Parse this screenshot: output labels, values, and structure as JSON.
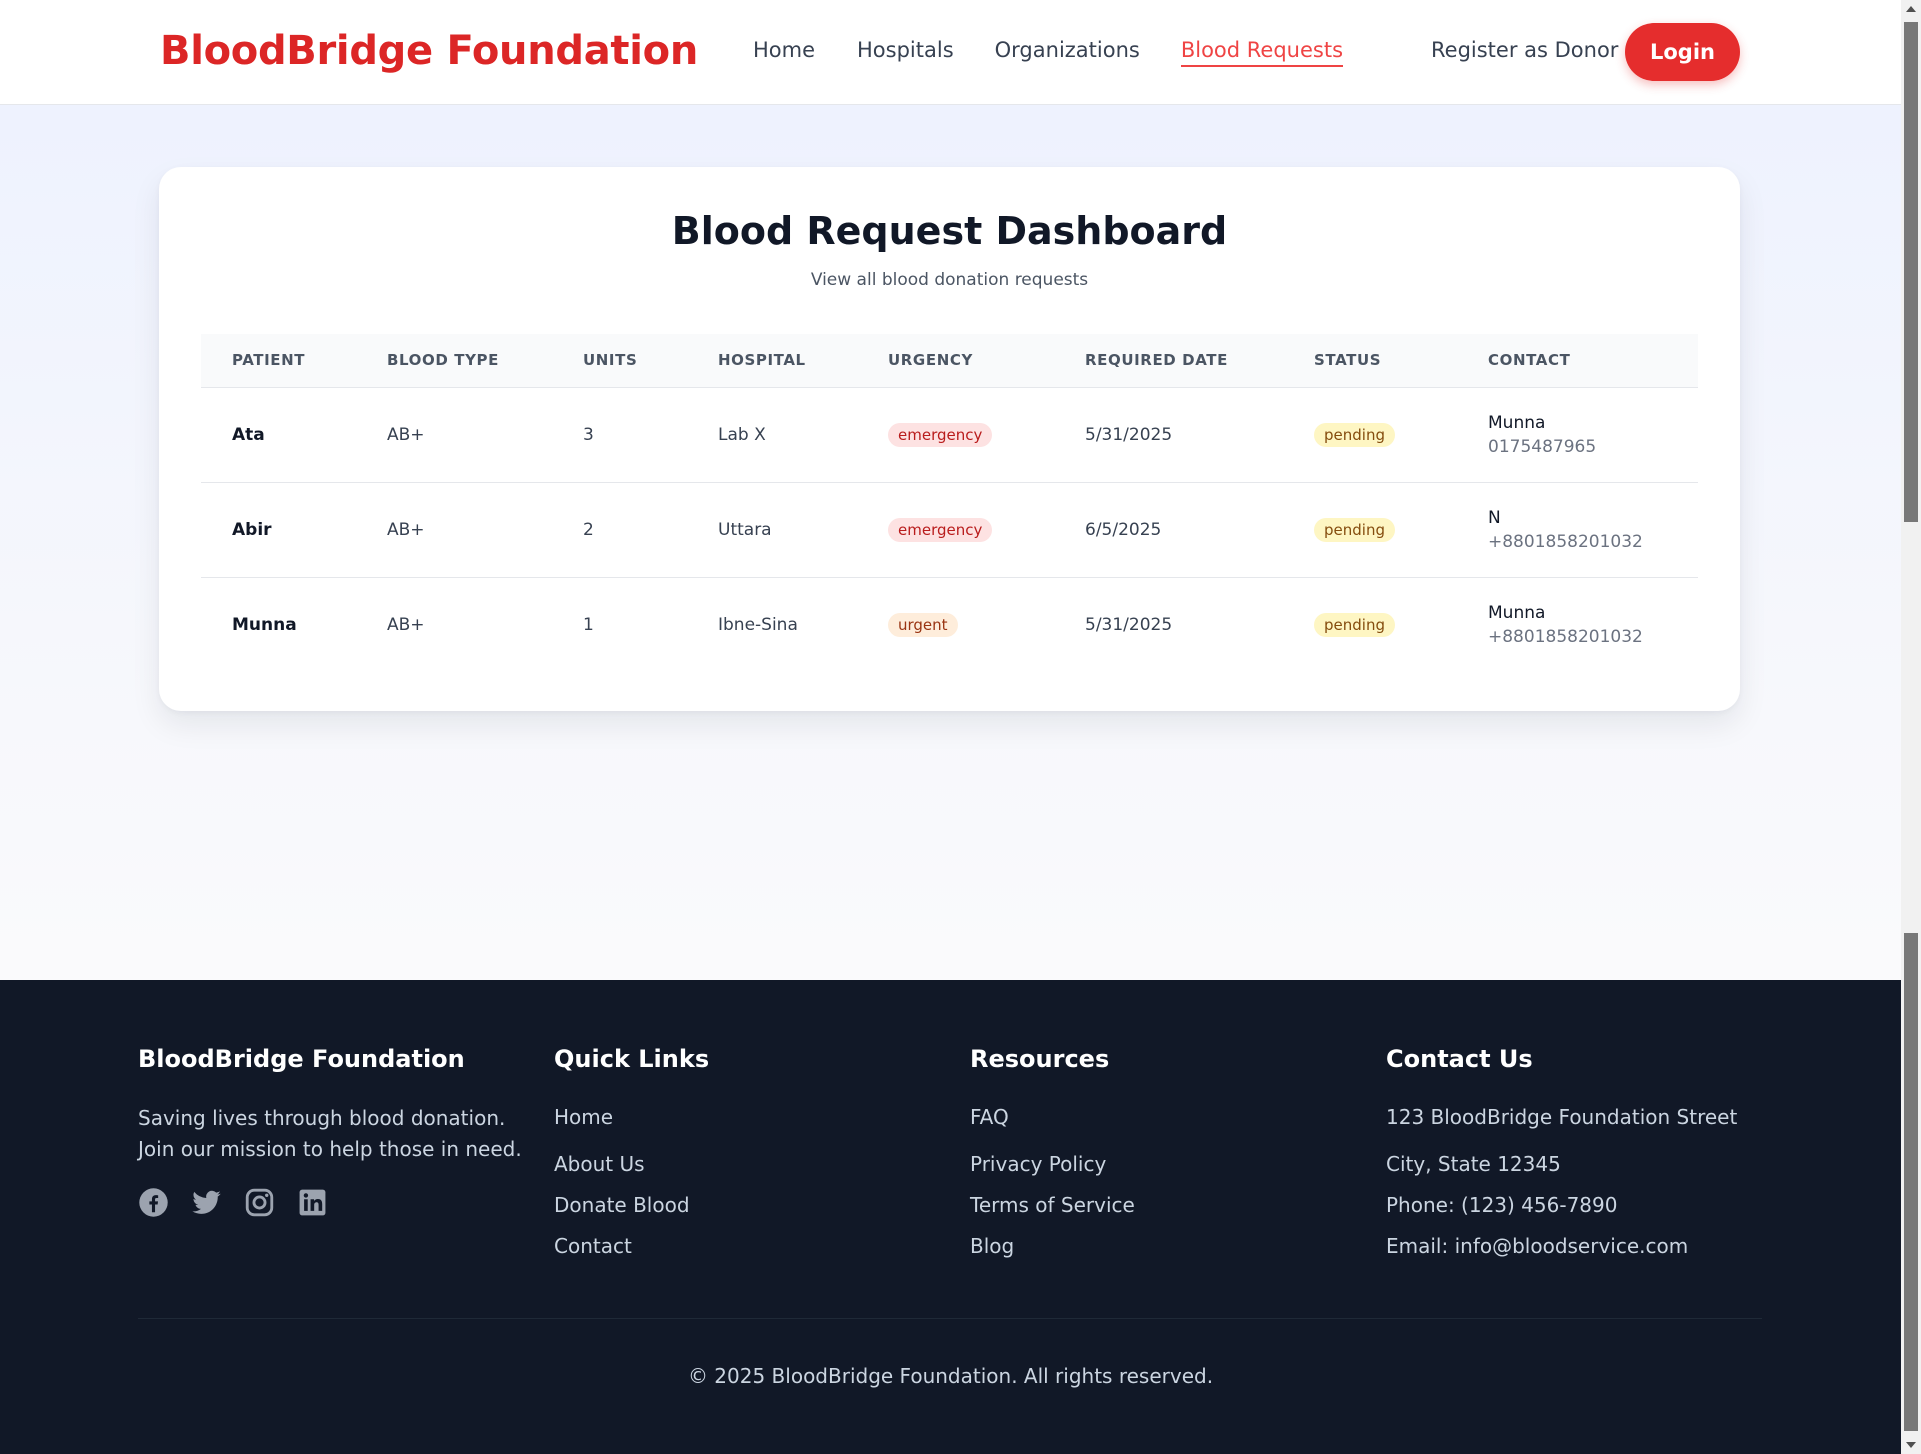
{
  "header": {
    "brand": "BloodBridge Foundation",
    "nav": [
      "Home",
      "Hospitals",
      "Organizations",
      "Blood Requests"
    ],
    "active_nav": "Blood Requests",
    "register_label": "Register as Donor",
    "login_label": "Login"
  },
  "dashboard": {
    "title": "Blood Request Dashboard",
    "subtitle": "View all blood donation requests",
    "columns": [
      "PATIENT",
      "BLOOD TYPE",
      "UNITS",
      "HOSPITAL",
      "URGENCY",
      "REQUIRED DATE",
      "STATUS",
      "CONTACT"
    ],
    "rows": [
      {
        "patient": "Ata",
        "blood_type": "AB+",
        "units": "3",
        "hospital": "Lab X",
        "urgency": "emergency",
        "required_date": "5/31/2025",
        "status": "pending",
        "contact_name": "Munna",
        "contact_phone": "0175487965"
      },
      {
        "patient": "Abir",
        "blood_type": "AB+",
        "units": "2",
        "hospital": "Uttara",
        "urgency": "emergency",
        "required_date": "6/5/2025",
        "status": "pending",
        "contact_name": "N",
        "contact_phone": "+8801858201032"
      },
      {
        "patient": "Munna",
        "blood_type": "AB+",
        "units": "1",
        "hospital": "Ibne-Sina",
        "urgency": "urgent",
        "required_date": "5/31/2025",
        "status": "pending",
        "contact_name": "Munna",
        "contact_phone": "+8801858201032"
      }
    ]
  },
  "footer": {
    "about": {
      "title": "BloodBridge Foundation",
      "text_line1": "Saving lives through blood donation.",
      "text_line2": "Join our mission to help those in need.",
      "socials": [
        "facebook-icon",
        "twitter-icon",
        "instagram-icon",
        "linkedin-icon"
      ]
    },
    "quick_links": {
      "title": "Quick Links",
      "items": [
        "Home",
        "About Us",
        "Donate Blood",
        "Contact"
      ]
    },
    "resources": {
      "title": "Resources",
      "items": [
        "FAQ",
        "Privacy Policy",
        "Terms of Service",
        "Blog"
      ]
    },
    "contact": {
      "title": "Contact Us",
      "items": [
        "123 BloodBridge Foundation Street",
        "City, State 12345",
        "Phone: (123) 456-7890",
        "Email: info@bloodservice.com"
      ]
    },
    "copyright": "© 2025 BloodBridge Foundation. All rights reserved."
  },
  "colors": {
    "brand": "#dc2626",
    "footer_bg": "#111827",
    "login_bg": "#e52d2d"
  }
}
